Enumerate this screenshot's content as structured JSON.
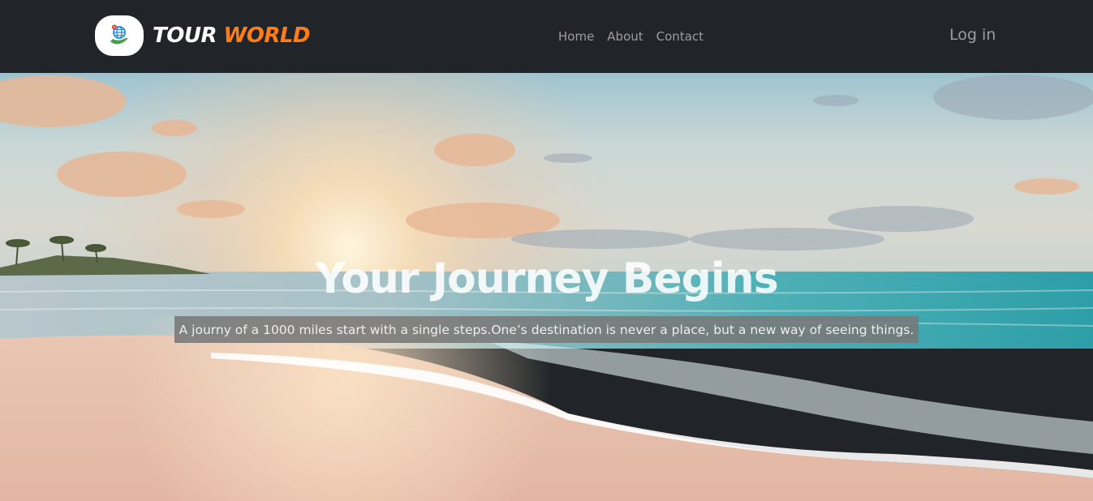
{
  "brand": {
    "word1": "TOUR",
    "word2": "WORLD",
    "logo_icon": "globe-hand-icon",
    "accent_color": "#fd7e14"
  },
  "nav": {
    "items": [
      {
        "label": "Home"
      },
      {
        "label": "About"
      },
      {
        "label": "Contact"
      }
    ],
    "login_label": "Log in"
  },
  "hero": {
    "headline": "Your Journey Begins",
    "tagline": "A journy of a 1000 miles start with a single steps.One’s destination is never a place, but a new way of seeing things.",
    "background": "beach-sunset-image"
  },
  "colors": {
    "navbar_bg": "#212529",
    "nav_text": "rgba(255,255,255,0.55)"
  }
}
